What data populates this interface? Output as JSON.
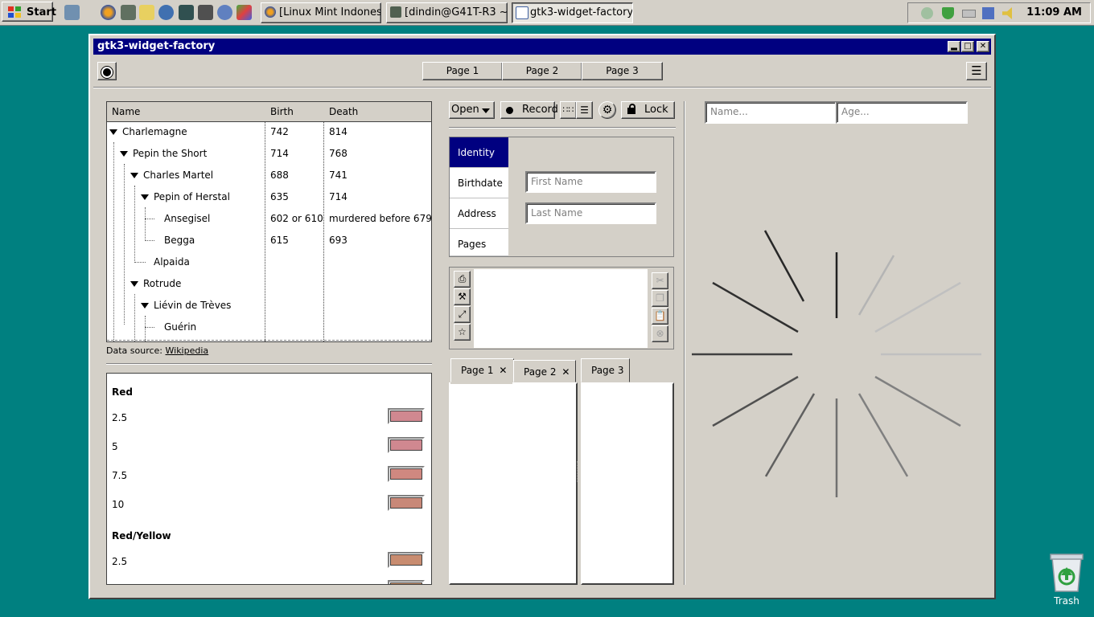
{
  "taskbar": {
    "start_label": "Start",
    "tasks": [
      {
        "label": "[Linux Mint Indonesi...",
        "icon": "firefox-icon"
      },
      {
        "label": "[dindin@G41T-R3 ~]",
        "icon": "terminal-icon"
      },
      {
        "label": "gtk3-widget-factory",
        "icon": "window-icon"
      }
    ],
    "clock": "11:09 AM"
  },
  "window": {
    "title": "gtk3-widget-factory",
    "pages": [
      "Page 1",
      "Page 2",
      "Page 3"
    ]
  },
  "tree": {
    "columns": [
      "Name",
      "Birth",
      "Death"
    ],
    "rows": [
      {
        "name": "Charlemagne",
        "birth": "742",
        "death": "814"
      },
      {
        "name": "Pepin the Short",
        "birth": "714",
        "death": "768"
      },
      {
        "name": "Charles Martel",
        "birth": "688",
        "death": "741"
      },
      {
        "name": "Pepin of Herstal",
        "birth": "635",
        "death": "714"
      },
      {
        "name": "Ansegisel",
        "birth": "602 or 610",
        "death": "murdered before 679"
      },
      {
        "name": "Begga",
        "birth": "615",
        "death": "693"
      },
      {
        "name": "Alpaida",
        "birth": "",
        "death": ""
      },
      {
        "name": "Rotrude",
        "birth": "",
        "death": ""
      },
      {
        "name": "Liévin de Trèves",
        "birth": "",
        "death": ""
      },
      {
        "name": "Guérin",
        "birth": "",
        "death": ""
      }
    ],
    "source_prefix": "Data source:",
    "source_link": "Wikipedia"
  },
  "colors": {
    "items": [
      {
        "label": "Red",
        "heading": true
      },
      {
        "label": "2.5",
        "color": "#d08890"
      },
      {
        "label": "5",
        "color": "#d08890"
      },
      {
        "label": "7.5",
        "color": "#d08880"
      },
      {
        "label": "10",
        "color": "#c88878"
      },
      {
        "label": "Red/Yellow",
        "heading": true
      },
      {
        "label": "2.5",
        "color": "#c88c70"
      }
    ]
  },
  "toolbar": {
    "open_label": "Open",
    "record_label": "Record",
    "lock_label": "Lock"
  },
  "sidebar": {
    "items": [
      "Identity",
      "Birthdate",
      "Address",
      "Pages"
    ],
    "first_name_placeholder": "First Name",
    "last_name_placeholder": "Last Name"
  },
  "notebooks": {
    "left_tabs": [
      "Page 1",
      "Page 2"
    ],
    "right_tabs": [
      "Page 3"
    ]
  },
  "entries": {
    "name_placeholder": "Name...",
    "age_placeholder": "Age..."
  },
  "desktop": {
    "trash_label": "Trash"
  }
}
